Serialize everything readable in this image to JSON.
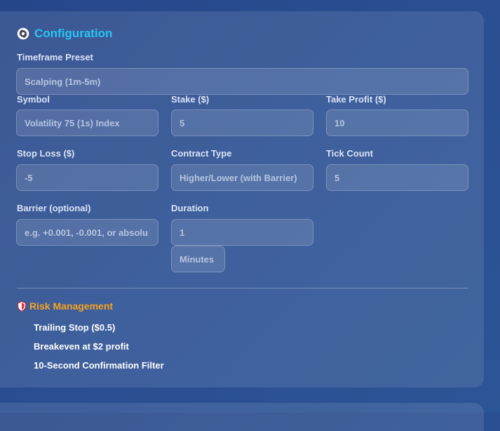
{
  "config": {
    "title": "Configuration",
    "icon": "gear-icon",
    "title_color": "#27c6f2",
    "timeframe": {
      "label": "Timeframe Preset",
      "value": "Scalping (1m-5m)"
    },
    "symbol": {
      "label": "Symbol",
      "value": "Volatility 75 (1s) Index"
    },
    "stake": {
      "label": "Stake ($)",
      "value": "5"
    },
    "take_profit": {
      "label": "Take Profit ($)",
      "value": "10"
    },
    "stop_loss": {
      "label": "Stop Loss ($)",
      "value": "-5"
    },
    "contract_type": {
      "label": "Contract Type",
      "value": "Higher/Lower (with Barrier)"
    },
    "tick_count": {
      "label": "Tick Count",
      "value": "5"
    },
    "barrier": {
      "label": "Barrier (optional)",
      "placeholder": "e.g. +0.001, -0.001, or absolu"
    },
    "duration": {
      "label": "Duration",
      "value": "1",
      "unit": "Minutes"
    }
  },
  "risk": {
    "title": "Risk Management",
    "icon": "shield-icon",
    "title_color": "#f9a21c",
    "items": [
      "Trailing Stop ($0.5)",
      "Breakeven at $2 profit",
      "10-Second Confirmation Filter"
    ]
  }
}
